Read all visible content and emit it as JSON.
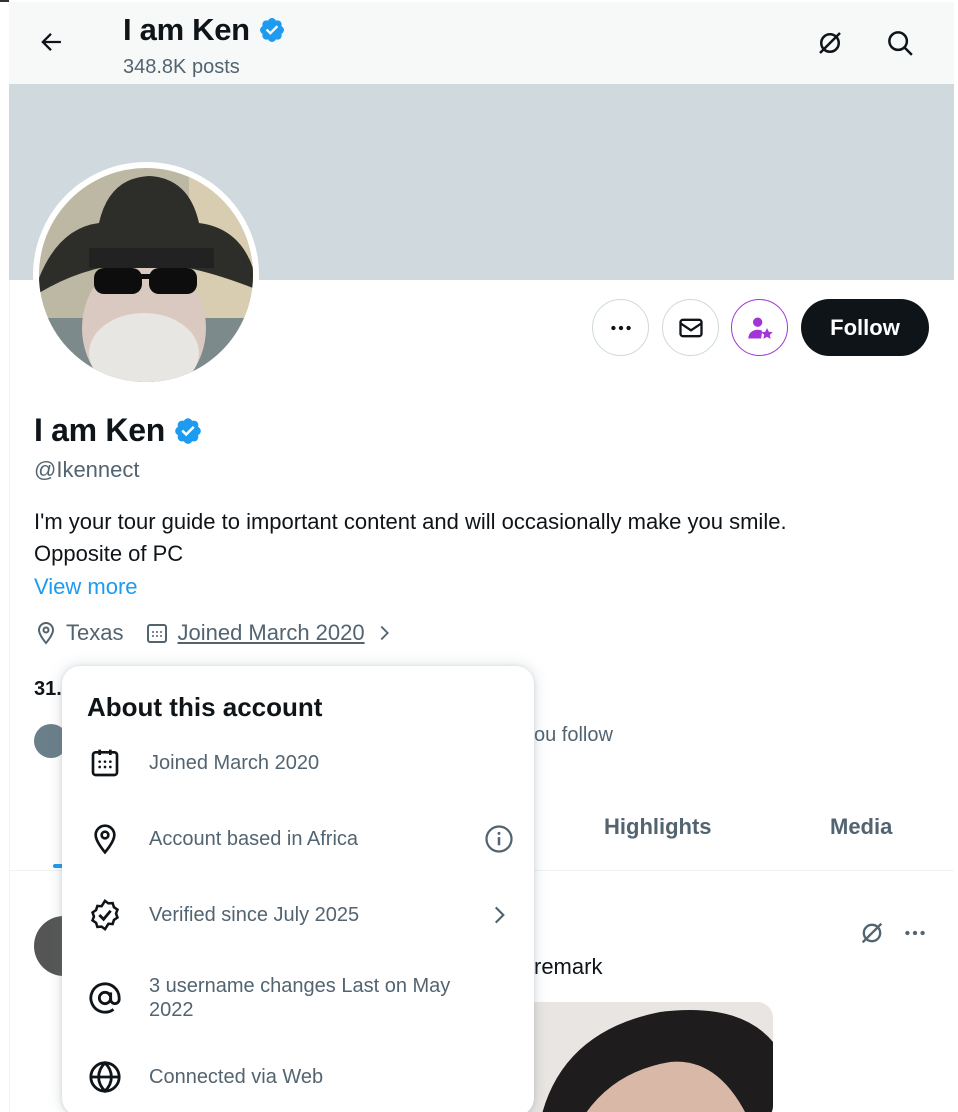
{
  "header": {
    "title": "I am Ken",
    "subtitle": "348.8K posts"
  },
  "profile": {
    "name": "I am Ken",
    "handle": "@Ikennect",
    "bio_line1": "I'm your tour guide to important content and will occasionally make you smile.",
    "bio_line2": "Opposite of PC",
    "view_more": "View more",
    "location": "Texas",
    "joined": "Joined March 2020",
    "counts_partial": "31.",
    "followed_by_partial": "ou follow",
    "follow_label": "Follow"
  },
  "tabs": [
    {
      "label": "Highlights"
    },
    {
      "label": "Media"
    }
  ],
  "post": {
    "text_partial": "remark"
  },
  "popover": {
    "title": "About this account",
    "rows": [
      {
        "icon": "calendar-icon",
        "text": "Joined March 2020"
      },
      {
        "icon": "location-pin-icon",
        "text": "Account based in Africa"
      },
      {
        "icon": "verified-badge-icon",
        "text": "Verified since July 2025"
      },
      {
        "icon": "at-sign-icon",
        "text": "3 username changes Last on May 2022"
      },
      {
        "icon": "globe-icon",
        "text": "Connected via Web"
      }
    ]
  },
  "colors": {
    "accent": "#1d9bf0",
    "text_primary": "#0f1419",
    "text_secondary": "#536471",
    "banner": "#cfd9de",
    "subscribe_purple": "#a335d8"
  }
}
